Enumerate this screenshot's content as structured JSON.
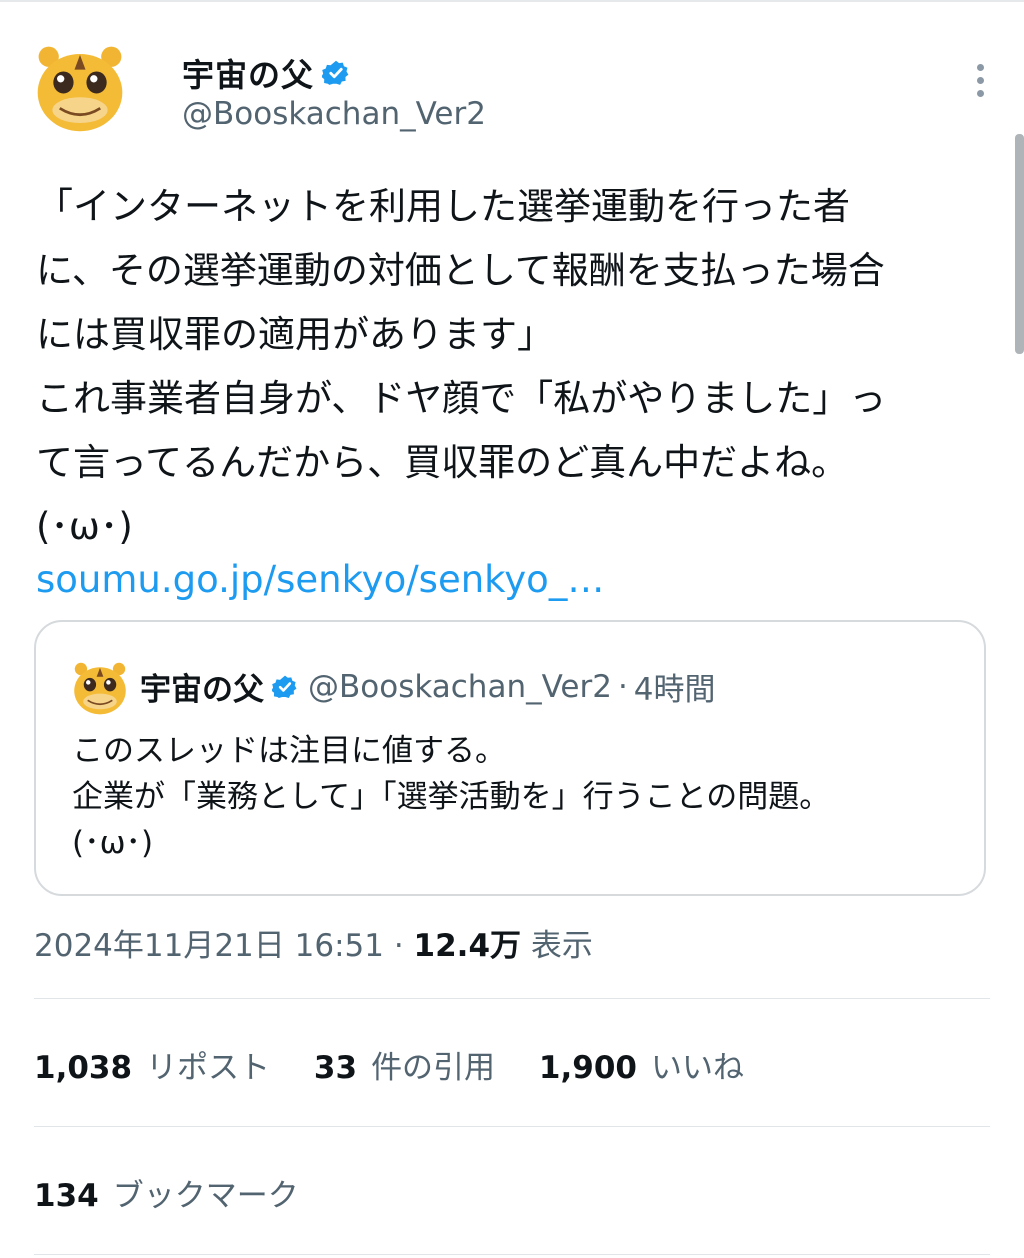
{
  "post": {
    "author": {
      "display_name": "宇宙の父",
      "handle": "@Booskachan_Ver2",
      "verified": true,
      "avatar_icon": "tiger-mascot-avatar"
    },
    "text": "「インターネットを利用した選挙運動を行った者\nに、その選挙運動の対価として報酬を支払った場合\nには買収罪の適用があります」\nこれ事業者自身が、ドヤ顔で「私がやりました」っ\nて言ってるんだから、買収罪のど真ん中だよね。\n(･ω･)",
    "link": "soumu.go.jp/senkyo/senkyo_…",
    "quote": {
      "display_name": "宇宙の父",
      "handle": "@Booskachan_Ver2",
      "separator": "·",
      "time": "4時間",
      "text": "このスレッドは注目に値する。\n企業が「業務として」「選挙活動を」行うことの問題。\n(･ω･)"
    },
    "timestamp": "2024年11月21日 16:51",
    "meta_sep": " · ",
    "views_count": "12.4万",
    "views_label": "表示"
  },
  "stats": {
    "reposts": {
      "count": "1,038",
      "label": "リポスト"
    },
    "quotes": {
      "count": "33",
      "label": "件の引用"
    },
    "likes": {
      "count": "1,900",
      "label": "いいね"
    },
    "bookmarks": {
      "count": "134",
      "label": "ブックマーク"
    }
  },
  "colors": {
    "link": "#1d9bf0",
    "verified": "#1d9bf0",
    "secondary": "#536471"
  }
}
